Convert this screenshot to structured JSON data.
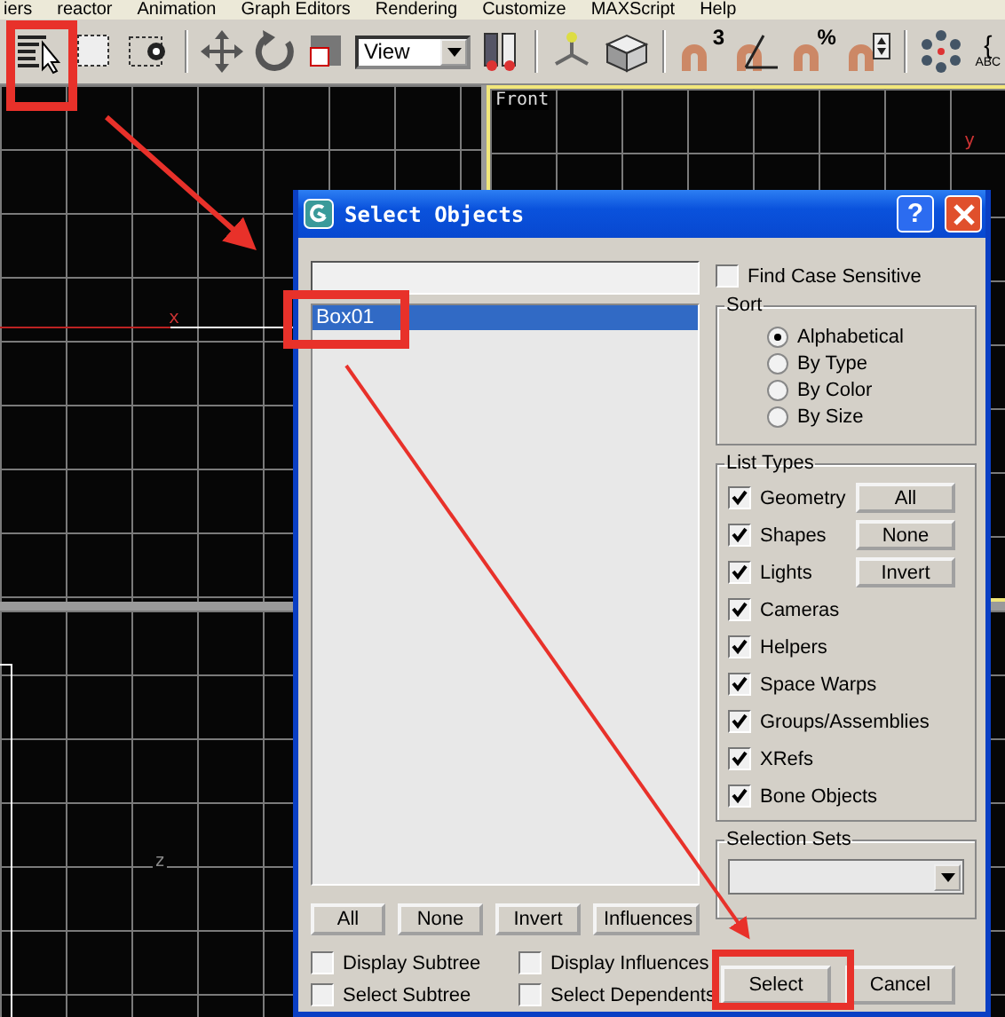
{
  "menu_bar": {
    "items": [
      "iers",
      "reactor",
      "Animation",
      "Graph Editors",
      "Rendering",
      "Customize",
      "MAXScript",
      "Help"
    ]
  },
  "toolbar": {
    "reference_dropdown": "View",
    "snap_3d_label": "3",
    "percent_snap_label": "%",
    "named_sets_brace": "{",
    "named_sets_caption": "ABC"
  },
  "viewports": [
    {
      "axis": "x",
      "active": false
    },
    {
      "label": "Front",
      "axis": "y",
      "active": true
    },
    {
      "axis": "z",
      "active": false
    }
  ],
  "dialog": {
    "title": "Select Objects",
    "help_button": "?",
    "objects": [
      {
        "name": "Box01",
        "selected": true
      }
    ],
    "list_buttons": [
      {
        "label": "All"
      },
      {
        "label": "None"
      },
      {
        "label": "Invert"
      },
      {
        "label": "Influences"
      }
    ],
    "options": [
      {
        "label": "Display Subtree",
        "checked": false
      },
      {
        "label": "Display Influences",
        "checked": false
      },
      {
        "label": "Select Subtree",
        "checked": false
      },
      {
        "label": "Select Dependents",
        "checked": false
      }
    ],
    "find_case_sensitive": {
      "label": "Find Case Sensitive",
      "checked": false
    },
    "sort": {
      "title": "Sort",
      "options": [
        {
          "label": "Alphabetical",
          "selected": true
        },
        {
          "label": "By Type",
          "selected": false
        },
        {
          "label": "By Color",
          "selected": false
        },
        {
          "label": "By Size",
          "selected": false
        }
      ]
    },
    "list_types": {
      "title": "List Types",
      "items": [
        {
          "label": "Geometry",
          "checked": true
        },
        {
          "label": "Shapes",
          "checked": true
        },
        {
          "label": "Lights",
          "checked": true
        },
        {
          "label": "Cameras",
          "checked": true
        },
        {
          "label": "Helpers",
          "checked": true
        },
        {
          "label": "Space Warps",
          "checked": true
        },
        {
          "label": "Groups/Assemblies",
          "checked": true
        },
        {
          "label": "XRefs",
          "checked": true
        },
        {
          "label": "Bone Objects",
          "checked": true
        }
      ],
      "buttons": [
        "All",
        "None",
        "Invert"
      ]
    },
    "selection_sets": {
      "title": "Selection Sets"
    },
    "actions": [
      "Select",
      "Cancel"
    ]
  }
}
